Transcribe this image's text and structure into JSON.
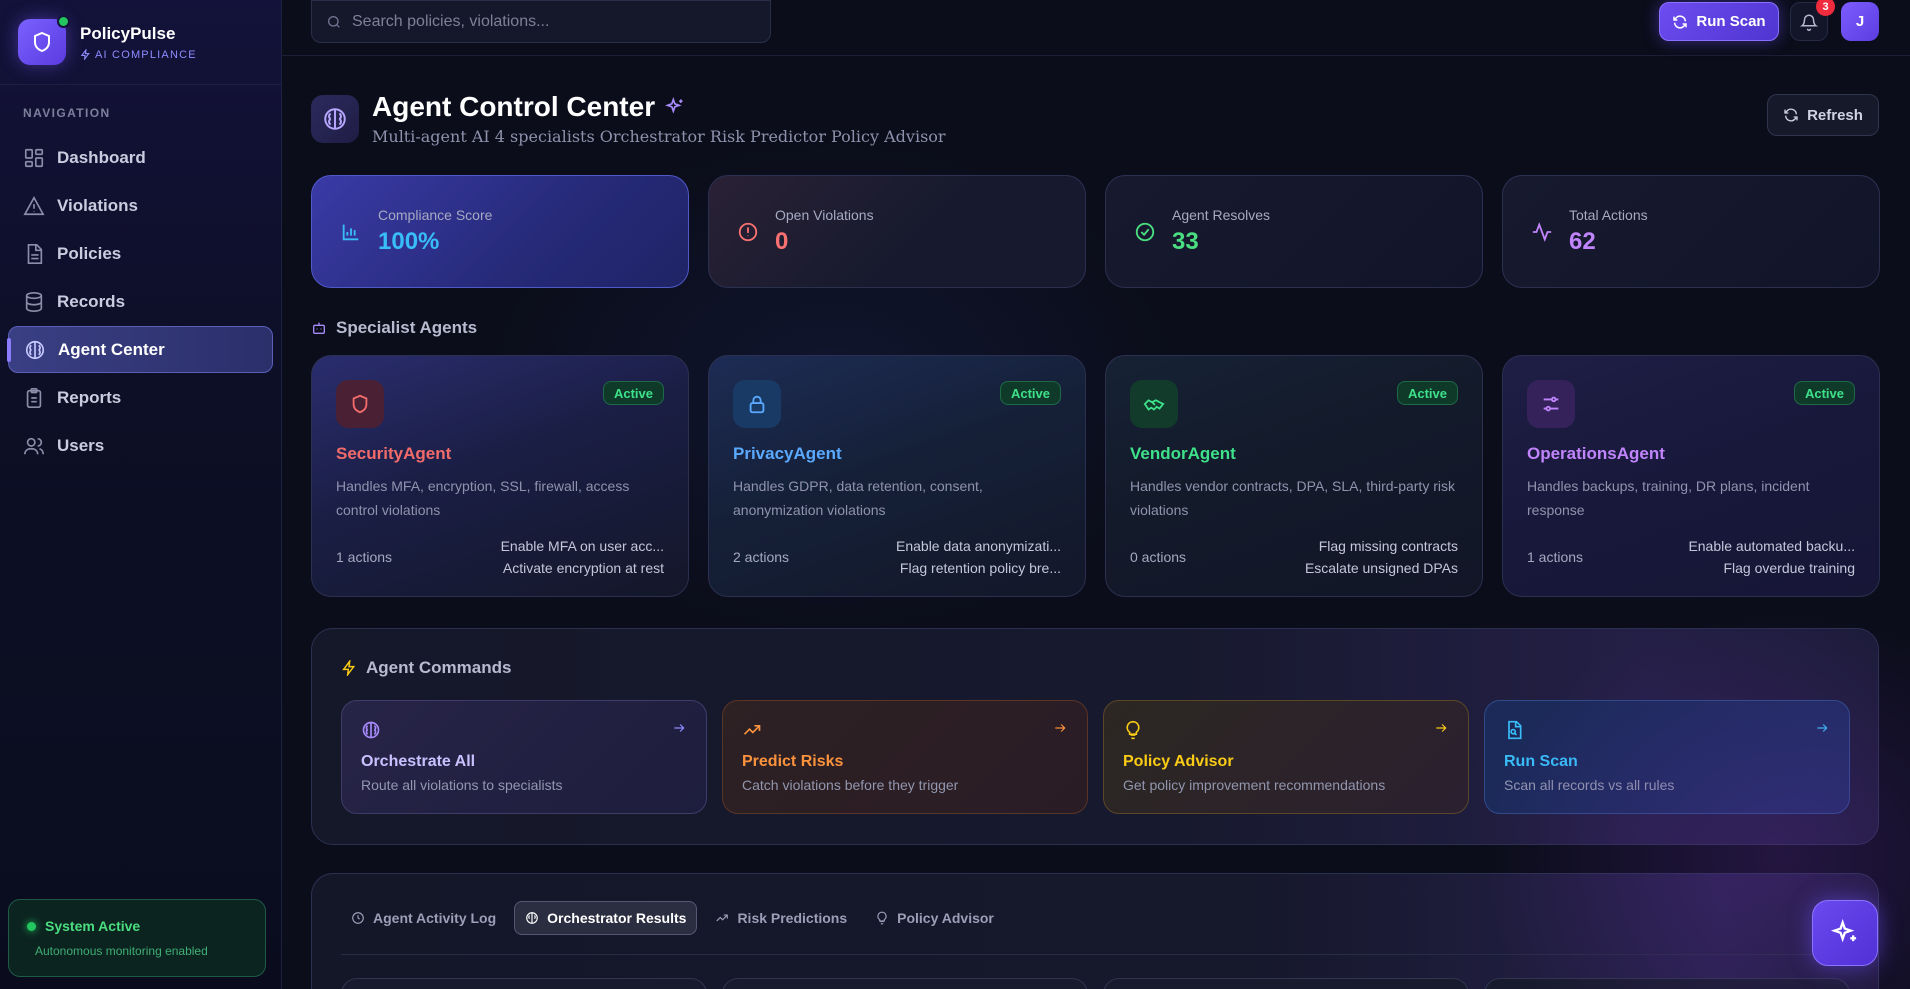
{
  "brand": {
    "name": "PolicyPulse",
    "subtitle": "AI COMPLIANCE"
  },
  "nav": {
    "label": "NAVIGATION",
    "items": [
      {
        "label": "Dashboard",
        "icon": "grid-icon"
      },
      {
        "label": "Violations",
        "icon": "warning-icon"
      },
      {
        "label": "Policies",
        "icon": "document-icon"
      },
      {
        "label": "Records",
        "icon": "database-icon"
      },
      {
        "label": "Agent Center",
        "icon": "brain-icon",
        "active": true
      },
      {
        "label": "Reports",
        "icon": "clipboard-icon"
      },
      {
        "label": "Users",
        "icon": "users-icon"
      }
    ]
  },
  "system": {
    "title": "System Active",
    "subtitle": "Autonomous monitoring enabled"
  },
  "topbar": {
    "search_placeholder": "Search policies, violations...",
    "run_scan_label": "Run Scan",
    "notification_count": "3",
    "avatar_initial": "J"
  },
  "page": {
    "title": "Agent Control Center",
    "subtitle": "Multi-agent AI 4 specialists Orchestrator Risk Predictor Policy Advisor",
    "refresh_label": "Refresh"
  },
  "stats": [
    {
      "label": "Compliance Score",
      "value": "100%",
      "color": "#38bdf8"
    },
    {
      "label": "Open Violations",
      "value": "0",
      "color": "#f87171"
    },
    {
      "label": "Agent Resolves",
      "value": "33",
      "color": "#4ade80"
    },
    {
      "label": "Total Actions",
      "value": "62",
      "color": "#c084fc"
    }
  ],
  "specialists": {
    "heading": "Specialist Agents",
    "agents": [
      {
        "name": "SecurityAgent",
        "status": "Active",
        "color": "#f26b6b",
        "description": "Handles MFA, encryption, SSL, firewall, access control violations",
        "actions_count": "1 actions",
        "actions": [
          "Enable MFA on user acc...",
          "Activate encryption at rest"
        ]
      },
      {
        "name": "PrivacyAgent",
        "status": "Active",
        "color": "#5aa9ff",
        "description": "Handles GDPR, data retention, consent, anonymization violations",
        "actions_count": "2 actions",
        "actions": [
          "Enable data anonymizati...",
          "Flag retention policy bre..."
        ]
      },
      {
        "name": "VendorAgent",
        "status": "Active",
        "color": "#3ee08a",
        "description": "Handles vendor contracts, DPA, SLA, third-party risk violations",
        "actions_count": "0 actions",
        "actions": [
          "Flag missing contracts",
          "Escalate unsigned DPAs"
        ]
      },
      {
        "name": "OperationsAgent",
        "status": "Active",
        "color": "#c084fc",
        "description": "Handles backups, training, DR plans, incident response",
        "actions_count": "1 actions",
        "actions": [
          "Enable automated backu...",
          "Flag overdue training"
        ]
      }
    ]
  },
  "commands": {
    "heading": "Agent Commands",
    "items": [
      {
        "title": "Orchestrate All",
        "description": "Route all violations to specialists",
        "color": "#c9c1ff"
      },
      {
        "title": "Predict Risks",
        "description": "Catch violations before they trigger",
        "color": "#fb923c"
      },
      {
        "title": "Policy Advisor",
        "description": "Get policy improvement recommendations",
        "color": "#facc15"
      },
      {
        "title": "Run Scan",
        "description": "Scan all records vs all rules",
        "color": "#38bdf8"
      }
    ]
  },
  "tabs": [
    {
      "label": "Agent Activity Log"
    },
    {
      "label": "Orchestrator Results",
      "active": true
    },
    {
      "label": "Risk Predictions"
    },
    {
      "label": "Policy Advisor"
    }
  ]
}
